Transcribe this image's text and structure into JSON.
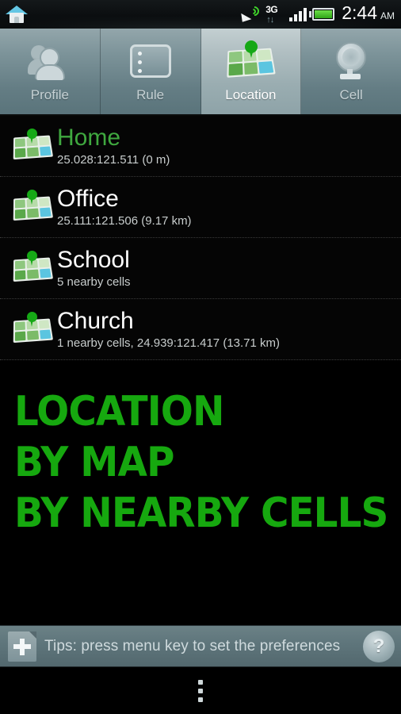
{
  "statusbar": {
    "home_icon": "home-icon",
    "gps_icon": "gps-satellite-icon",
    "network_label": "3G",
    "network_arrows": "↑↓",
    "signal_icon": "signal-bars-icon",
    "battery_icon": "battery-icon",
    "time": "2:44",
    "ampm": "AM"
  },
  "tabs": [
    {
      "label": "Profile",
      "icon": "profile-icon",
      "selected": false
    },
    {
      "label": "Rule",
      "icon": "rule-icon",
      "selected": false
    },
    {
      "label": "Location",
      "icon": "map-icon",
      "selected": true
    },
    {
      "label": "Cell",
      "icon": "cell-tower-icon",
      "selected": false
    }
  ],
  "list": [
    {
      "title": "Home",
      "sub": "25.028:121.511  (0 m)",
      "active": true,
      "icon": "map-pin-icon"
    },
    {
      "title": "Office",
      "sub": "25.111:121.506  (9.17 km)",
      "active": false,
      "icon": "map-pin-icon"
    },
    {
      "title": "School",
      "sub": "5 nearby cells",
      "active": false,
      "icon": "map-pin-icon"
    },
    {
      "title": "Church",
      "sub": "1 nearby cells, 24.939:121.417  (13.71 km)",
      "active": false,
      "icon": "map-pin-icon"
    }
  ],
  "headlines": [
    "LOCATION",
    "BY MAP",
    "BY NEARBY CELLS"
  ],
  "tips": {
    "add_icon": "add-document-icon",
    "text": "Tips: press menu key to set the preferences",
    "help_icon": "help-icon",
    "help_glyph": "?"
  },
  "navbar": {
    "overflow_icon": "overflow-menu-icon"
  },
  "colors": {
    "accent_green": "#3fa83f",
    "headline_green": "#16a80f",
    "tab_selected_text": "#ffffff",
    "tab_text": "#c6d2d5",
    "list_title": "#ffffff",
    "list_sub": "#c8cdcd",
    "background": "#000000",
    "tips_bar": "#5e757b"
  }
}
